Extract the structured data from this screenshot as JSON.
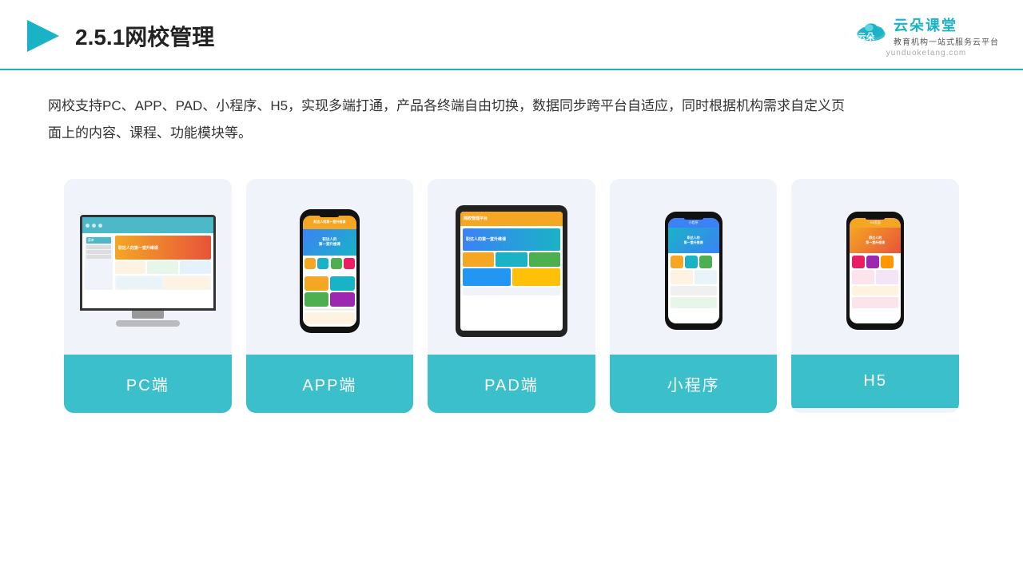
{
  "header": {
    "title": "2.5.1网校管理",
    "logo_cn": "云朵课堂",
    "logo_en": "yunduoketang.com",
    "logo_subtitle": "教育机构一站\n式服务云平台"
  },
  "description": {
    "text": "网校支持PC、APP、PAD、小程序、H5，实现多端打通，产品各终端自由切换，数据同步跨平台自适应，同时根据机构需求自定义页面上的内容、课程、功能模块等。"
  },
  "cards": [
    {
      "label": "PC端"
    },
    {
      "label": "APP端"
    },
    {
      "label": "PAD端"
    },
    {
      "label": "小程序"
    },
    {
      "label": "H5"
    }
  ],
  "colors": {
    "teal": "#3bbfcb",
    "accent": "#1ab3c6",
    "border": "#1ab3c6"
  }
}
